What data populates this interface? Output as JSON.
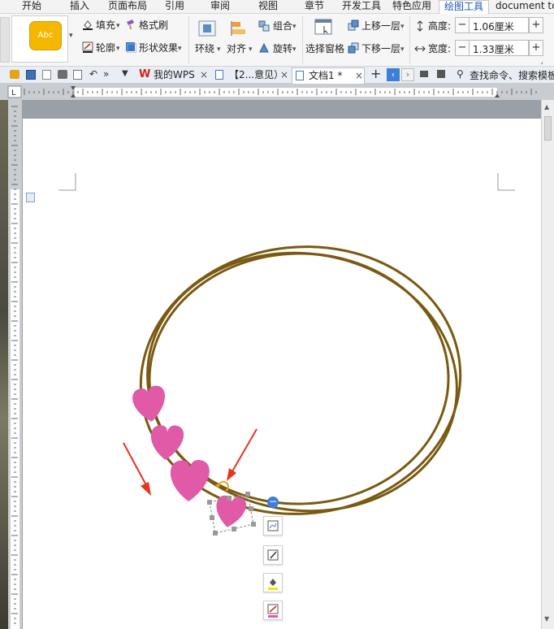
{
  "menu": {
    "tabs": [
      "开始",
      "插入",
      "页面布局",
      "引用",
      "审阅",
      "视图",
      "章节",
      "开发工具",
      "特色应用",
      "绘图工具",
      "document tc"
    ],
    "active": "绘图工具"
  },
  "ribbon": {
    "style_preview": "Abc",
    "fill_label": "填充",
    "format_painter_label": "格式刷",
    "outline_label": "轮廓",
    "shape_effect_label": "形状效果",
    "wrap_label": "环绕",
    "align_label": "对齐",
    "group_label": "组合",
    "rotate_label": "旋转",
    "selection_pane_label": "选择窗格",
    "bring_forward_label": "上移一层",
    "send_backward_label": "下移一层",
    "height_label": "高度:",
    "height_value": "1.06厘米",
    "width_label": "宽度:",
    "width_value": "1.33厘米",
    "minus": "−",
    "plus": "+"
  },
  "tabstrip": {
    "wps_label": "我的WPS",
    "doc2_label": "【2...意见）",
    "doc1_label": "文档1 *",
    "search_label": "查找命令、搜索模板",
    "close": "×",
    "new_tab": "+"
  },
  "colors": {
    "ring": "#7a5a10",
    "heart": "#e05aa8",
    "arrow": "#e8321e",
    "accent": "#1a56b8",
    "style_swatch": "#f5b800"
  },
  "icons": [
    "fill-icon",
    "format-painter-icon",
    "outline-icon",
    "shape-effect-icon",
    "wrap-icon",
    "align-icon",
    "group-icon",
    "rotate-icon",
    "selection-pane-icon",
    "bring-forward-icon",
    "send-backward-icon",
    "height-icon",
    "width-icon",
    "wps-logo-icon",
    "document-icon",
    "close-icon",
    "rotate-handle-icon",
    "collapse-icon",
    "layout-options-icon",
    "edit-shape-icon",
    "fill-color-icon",
    "outline-color-icon"
  ]
}
